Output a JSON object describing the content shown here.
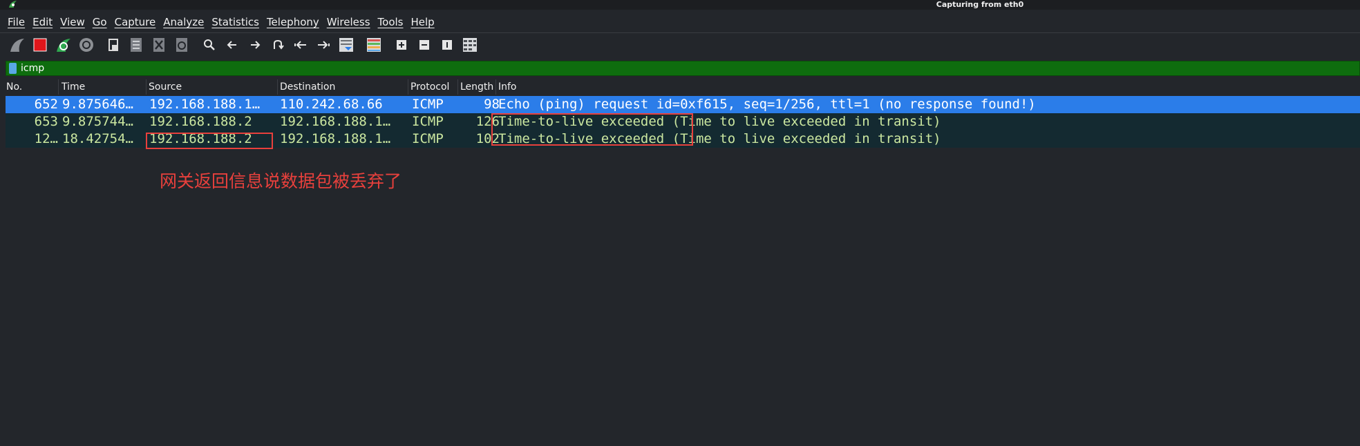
{
  "window": {
    "title": "Capturing from eth0"
  },
  "menu": [
    "File",
    "Edit",
    "View",
    "Go",
    "Capture",
    "Analyze",
    "Statistics",
    "Telephony",
    "Wireless",
    "Tools",
    "Help"
  ],
  "toolbar": {
    "icons": [
      "shark-fin-start-icon",
      "stop-capture-icon",
      "restart-capture-icon",
      "capture-options-icon",
      "open-file-icon",
      "save-file-icon",
      "close-file-icon",
      "reload-file-icon",
      "search-icon",
      "back-arrow-icon",
      "forward-arrow-icon",
      "go-to-packet-icon",
      "first-packet-icon",
      "last-packet-icon",
      "auto-scroll-icon",
      "colorize-icon",
      "zoom-in-icon",
      "zoom-out-icon",
      "normal-size-icon",
      "resize-columns-icon"
    ]
  },
  "filter": {
    "value": "icmp"
  },
  "packet_list": {
    "columns": [
      "No.",
      "Time",
      "Source",
      "Destination",
      "Protocol",
      "Length",
      "Info"
    ],
    "rows": [
      {
        "no": "652",
        "time": "9.875646…",
        "source": "192.168.188.1…",
        "destination": "110.242.68.66",
        "protocol": "ICMP",
        "length": "98",
        "info": "Echo (ping) request  id=0xf615, seq=1/256, ttl=1 (no response found!)"
      },
      {
        "no": "653",
        "time": "9.875744…",
        "source": "192.168.188.2",
        "destination": "192.168.188.1…",
        "protocol": "ICMP",
        "length": "126",
        "info": "Time-to-live exceeded (Time to live exceeded in transit)"
      },
      {
        "no": "12…",
        "time": "18.42754…",
        "source": "192.168.188.2",
        "destination": "192.168.188.1…",
        "protocol": "ICMP",
        "length": "102",
        "info": "Time-to-live exceeded (Time to live exceeded in transit)"
      }
    ]
  },
  "annotation": {
    "text": "网关返回信息说数据包被丢弃了"
  },
  "colors": {
    "selected_row": "#2b7de9",
    "ttl_row_bg": "#142a31",
    "ttl_row_fg": "#cbe7a0",
    "filter_bg": "#0e6d0e",
    "annotation": "#e8403c"
  }
}
